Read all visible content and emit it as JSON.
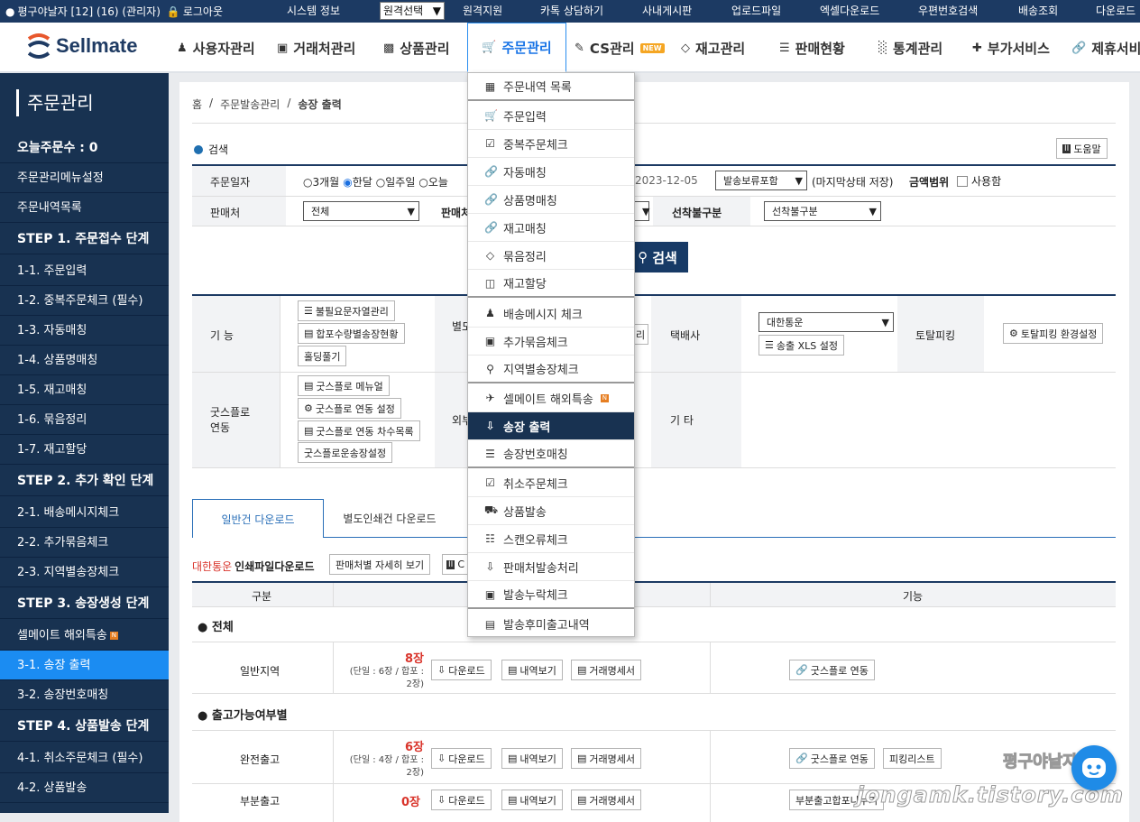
{
  "topbar": {
    "user": "평구야날자 [12] (16) (관리자)",
    "logout": "로그아웃",
    "links": [
      "시스템 정보",
      "원격지원",
      "카톡 상담하기",
      "사내게시판",
      "업로드파일",
      "엑셀다운로드",
      "우편번호검색",
      "배송조회",
      "다운로드"
    ],
    "remote_select": "원격선택"
  },
  "logo": {
    "text": "Sellmate"
  },
  "nav": {
    "items": [
      "사용자관리",
      "거래처관리",
      "상품관리",
      "주문관리",
      "CS관리",
      "재고관리",
      "판매현황",
      "통계관리",
      "부가서비스",
      "제휴서비"
    ],
    "new_badge": "NEW"
  },
  "sidebar": {
    "title": "주문관리",
    "items": [
      "오늘주문수 : 0",
      "주문관리메뉴설정",
      "주문내역목록",
      "STEP 1. 주문접수 단계",
      "1-1. 주문입력",
      "1-2. 중복주문체크 (필수)",
      "1-3. 자동매칭",
      "1-4. 상품명매칭",
      "1-5. 재고매칭",
      "1-6. 묶음정리",
      "1-7. 재고할당",
      "STEP 2. 추가 확인 단계",
      "2-1. 배송메시지체크",
      "2-2. 추가묶음체크",
      "2-3. 지역별송장체크",
      "STEP 3. 송장생성 단계",
      "셀메이트 해외특송",
      "3-1. 송장 출력",
      "3-2. 송장번호매칭",
      "STEP 4. 상품발송 단계",
      "4-1. 취소주문체크 (필수)",
      "4-2. 상품발송"
    ],
    "overseas_badge": "N"
  },
  "breadcrumb": {
    "home": "홈",
    "mid": "주문발송관리",
    "current": "송장 출력"
  },
  "search": {
    "title": "검색",
    "help": "도움말",
    "order_date_label": "주문일자",
    "radios": [
      "3개월",
      "한달",
      "일주일",
      "오늘"
    ],
    "date_end": "2023-12-05",
    "status_select": "발송보류포함",
    "save_note": "(마지막상태 저장)",
    "amount_label": "금액범위",
    "use_label": "사용함",
    "seller_label": "판매처",
    "seller_value": "전체",
    "seller2_label": "판매처",
    "prepaid_label": "선착불구분",
    "prepaid_value": "선착불구분",
    "search_button": "검색"
  },
  "functions": {
    "func_label": "기 능",
    "func_buttons": [
      "불필요문자열관리",
      "합포수량별송장현황",
      "홀딩풀기"
    ],
    "mid_label": "별도관리",
    "mid_button_tail": "리",
    "courier_label": "택배사",
    "courier_value": "대한통운",
    "xls_button": "송출 XLS 설정",
    "picking_label": "토탈피킹",
    "picking_button": "토탈피킹 환경설정",
    "goods_label": "굿스플로 연동",
    "goods_buttons": [
      "굿스플로 메뉴얼",
      "굿스플로 연동 설정",
      "굿스플로 연동 차수목록",
      "굿스플로운송장설정"
    ],
    "ext_label": "외부",
    "etc_label": "기 타"
  },
  "tabs": [
    "일반건 다운로드",
    "별도인쇄건 다운로드"
  ],
  "print_row": {
    "courier": "대한통운",
    "label": "인쇄파일다운로드",
    "detail_button": "판매처별 자세히 보기"
  },
  "table": {
    "headers": [
      "구분",
      "기능"
    ],
    "sections": [
      {
        "title": "전체",
        "rows": [
          {
            "name": "일반지역",
            "count": "8장",
            "detail": "(단일 : 6장 / 합포 : 2장)",
            "right_buttons": [
              "굿스플로 연동"
            ]
          }
        ]
      },
      {
        "title": "출고가능여부별",
        "rows": [
          {
            "name": "완전출고",
            "count": "6장",
            "detail": "(단일 : 4장 / 합포 : 2장)",
            "right_buttons": [
              "굿스플로 연동",
              "피킹리스트"
            ]
          },
          {
            "name": "부분출고",
            "count": "0장",
            "detail": "",
            "right_buttons": [
              "부분출고합포나누기"
            ]
          }
        ]
      }
    ],
    "action_buttons": [
      "다운로드",
      "내역보기",
      "거래명세서"
    ]
  },
  "dropdown": {
    "items": [
      "주문내역 목록",
      "주문입력",
      "중복주문체크",
      "자동매칭",
      "상품명매칭",
      "재고매칭",
      "묶음정리",
      "재고할당",
      "배송메시지 체크",
      "추가묶음체크",
      "지역별송장체크",
      "셀메이트 해외특송",
      "송장 출력",
      "송장번호매칭",
      "취소주문체크",
      "상품발송",
      "스캔오류체크",
      "판매처발송처리",
      "발송누락체크",
      "발송후미출고내역"
    ]
  },
  "watermark": {
    "line1": "평구야날자",
    "line2": "jongamk.tistory.com"
  },
  "colors": {
    "navy": "#1c3a63",
    "sidebar": "#183251",
    "active_blue": "#1b8cf2",
    "accent": "#1773e6",
    "red": "#d9342b"
  }
}
